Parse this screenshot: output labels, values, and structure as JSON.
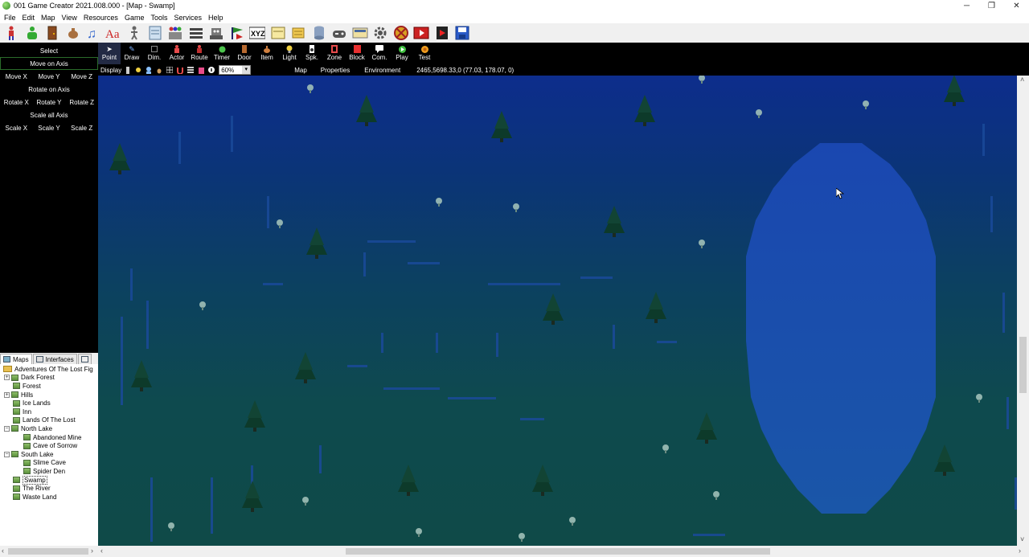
{
  "window": {
    "title": "001 Game Creator 2021.008.000 - [Map - Swamp]",
    "controls": [
      "─",
      "❐",
      "✕"
    ]
  },
  "menu": [
    "File",
    "Edit",
    "Map",
    "View",
    "Resources",
    "Game",
    "Tools",
    "Services",
    "Help"
  ],
  "left_panel": {
    "select": "Select",
    "move_on_axis": "Move on Axis",
    "move": [
      "Move X",
      "Move Y",
      "Move Z"
    ],
    "rotate_on_axis": "Rotate on Axis",
    "rotate": [
      "Rotate X",
      "Rotate Y",
      "Rotate Z"
    ],
    "scale_all_axis": "Scale all Axis",
    "scale": [
      "Scale X",
      "Scale Y",
      "Scale Z"
    ]
  },
  "tree_tabs": {
    "maps": "Maps",
    "interfaces": "Interfaces"
  },
  "tree": {
    "root": "Adventures Of The Lost Fig",
    "nodes": {
      "dark_forest": "Dark Forest",
      "forest": "Forest",
      "hills": "Hills",
      "ice_lands": "Ice Lands",
      "inn": "Inn",
      "lands_of_the_lost": "Lands Of The Lost",
      "north_lake": "North Lake",
      "abandoned_mine": "Abandoned Mine",
      "cave_of_sorrow": "Cave of Sorrow",
      "south_lake": "South Lake",
      "slime_cave": "Slime Cave",
      "spider_den": "Spider Den",
      "swamp": "Swamp",
      "the_river": "The River",
      "waste_land": "Waste Land"
    }
  },
  "map_tools": [
    {
      "label": "Point",
      "icon": "pointer-icon",
      "color": "#ffffff"
    },
    {
      "label": "Draw",
      "icon": "pencil-icon",
      "color": "#7ab0ff"
    },
    {
      "label": "Dim.",
      "icon": "dimension-icon",
      "color": "#888888"
    },
    {
      "label": "Actor",
      "icon": "actor-icon",
      "color": "#e84c4c"
    },
    {
      "label": "Route",
      "icon": "route-icon",
      "color": "#e84c4c"
    },
    {
      "label": "Timer",
      "icon": "timer-icon",
      "color": "#4cc44c"
    },
    {
      "label": "Door",
      "icon": "door-icon",
      "color": "#b86a30"
    },
    {
      "label": "Item",
      "icon": "item-icon",
      "color": "#d08040"
    },
    {
      "label": "Light",
      "icon": "light-icon",
      "color": "#f0d040"
    },
    {
      "label": "Spk.",
      "icon": "speaker-icon",
      "color": "#ffffff"
    },
    {
      "label": "Zone",
      "icon": "zone-icon",
      "color": "#e84c4c"
    },
    {
      "label": "Block",
      "icon": "block-icon",
      "color": "#e83030"
    },
    {
      "label": "Com.",
      "icon": "comment-icon",
      "color": "#ffffff"
    },
    {
      "label": "Play",
      "icon": "play-icon",
      "color": "#40c040"
    },
    {
      "label": "Test",
      "icon": "test-icon",
      "color": "#f0a020"
    }
  ],
  "display_bar": {
    "label": "Display",
    "zoom": "60%",
    "tabs": [
      "Map",
      "Properties",
      "Environment"
    ],
    "coordinates": "2465,5698.33,0 (77.03, 178.07, 0)"
  },
  "map_name": "Swamp",
  "colors": {
    "panel_bg": "#000000",
    "accent_green": "#2a6b2a",
    "water": "#1a4aa8",
    "grass": "#0f4a48"
  }
}
